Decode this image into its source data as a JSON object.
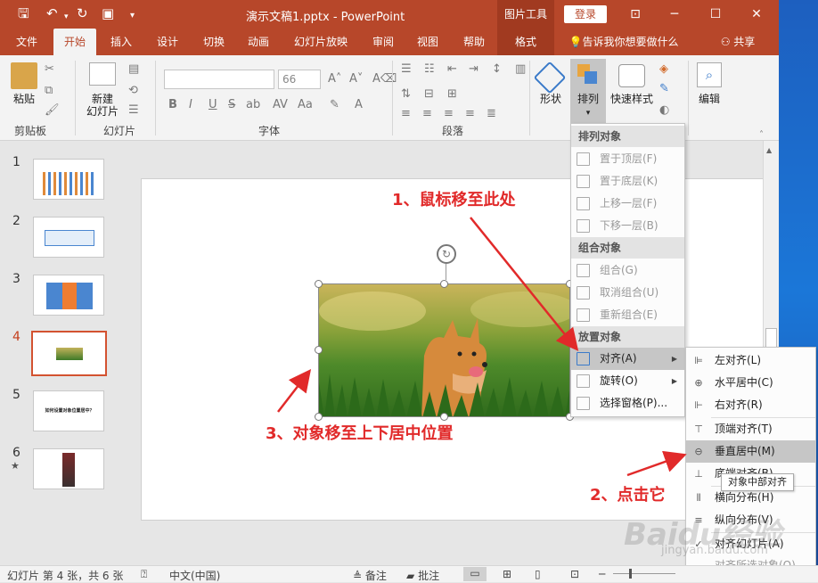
{
  "titlebar": {
    "title": "演示文稿1.pptx  -  PowerPoint",
    "context_tab": "图片工具",
    "login": "登录",
    "minimize": "─",
    "maximize": "☐",
    "close": "✕"
  },
  "tabs": [
    "文件",
    "开始",
    "插入",
    "设计",
    "切换",
    "动画",
    "幻灯片放映",
    "审阅",
    "视图",
    "帮助",
    "格式"
  ],
  "tell_me": "告诉我你想要做什么",
  "share": "共享",
  "ribbon": {
    "paste": "粘贴",
    "new_slide": "新建\n幻灯片",
    "font_size": "66",
    "shape": "形状",
    "arrange": "排列",
    "quick_styles": "快速样式",
    "edit": "编辑",
    "bold": "B",
    "italic": "I",
    "underline": "U",
    "strike": "S",
    "shadow": "ab",
    "spacing": "AV",
    "case": "Aa",
    "groups": [
      "剪贴板",
      "幻灯片",
      "字体",
      "段落"
    ]
  },
  "slides": [
    {
      "num": "1"
    },
    {
      "num": "2"
    },
    {
      "num": "3"
    },
    {
      "num": "4",
      "selected": true
    },
    {
      "num": "5",
      "text": "如何设置对象位置居中？"
    },
    {
      "num": "6",
      "star": "★"
    }
  ],
  "menu": {
    "h1": "排列对象",
    "bring_front": "置于顶层(F)",
    "send_back": "置于底层(K)",
    "forward": "上移一层(F)",
    "backward": "下移一层(B)",
    "h2": "组合对象",
    "group": "组合(G)",
    "ungroup": "取消组合(U)",
    "regroup": "重新组合(E)",
    "h3": "放置对象",
    "align": "对齐(A)",
    "rotate": "旋转(O)",
    "pane": "选择窗格(P)..."
  },
  "submenu": {
    "left": "左对齐(L)",
    "center_h": "水平居中(C)",
    "right": "右对齐(R)",
    "top": "顶端对齐(T)",
    "middle": "垂直居中(M)",
    "bottom": "底端对齐(B)",
    "dist_h": "横向分布(H)",
    "dist_v": "纵向分布(V)",
    "to_slide": "对齐幻灯片(A)",
    "to_selected": "对齐所选对象(O)",
    "check": "✓"
  },
  "tooltip": "对象中部对齐",
  "annotations": {
    "a1": "1、鼠标移至此处",
    "a2": "2、点击它",
    "a3": "3、对象移至上下居中位置"
  },
  "status": {
    "slide": "幻灯片 第 4 张，共 6 张",
    "lang": "中文(中国)",
    "notes": "备注",
    "comments": "批注"
  },
  "watermark": "Baidu经验",
  "watermark_sub": "jingyan.baidu.com",
  "colors": {
    "accent": "#b7472a",
    "arrow": "#e12a2a",
    "highlight": "#c6c6c6"
  }
}
